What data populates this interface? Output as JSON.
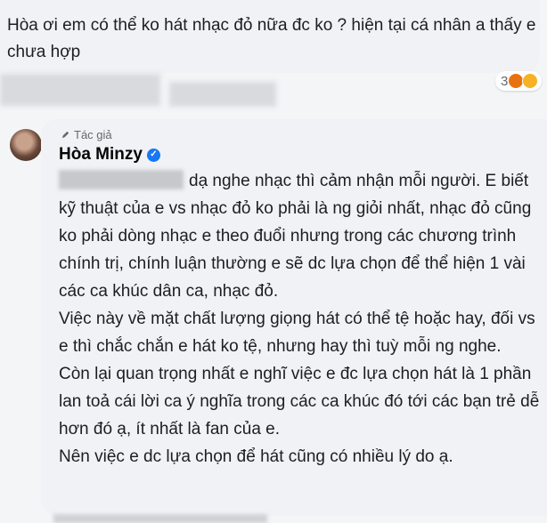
{
  "top_comment": {
    "text": "Hòa ơi em có thể ko hát nhạc đỏ nữa đc ko ? hiện tại cá nhân a thấy e chưa hợp",
    "reaction_count": "3",
    "reactions": [
      "angry-emoji",
      "haha-emoji"
    ]
  },
  "reply": {
    "author_tag": "Tác giả",
    "author_name": "Hòa Minzy",
    "paragraphs": [
      "dạ nghe nhạc thì cảm nhận mỗi người. E biết kỹ thuật của e vs nhạc đỏ ko phải là ng giỏi nhất, nhạc đỏ cũng ko phải dòng nhạc e theo đuổi nhưng trong các chương trình chính trị, chính luận thường e sẽ dc lựa chọn để thể hiện 1 vài các ca khúc dân ca, nhạc đỏ.",
      "Việc này về mặt chất lượng giọng hát có thể tệ hoặc hay, đối vs e thì chắc chắn e hát ko tệ, nhưng hay thì tuỳ mỗi ng nghe.",
      "Còn lại quan trọng nhất e nghĩ việc e đc lựa chọn hát là 1 phần lan toả cái lời ca ý nghĩa trong các ca khúc đó tới các bạn trẻ dễ hơn đó ạ, ít nhất là fan của e.",
      "Nên việc e dc lựa chọn để hát cũng có nhiều lý do ạ."
    ]
  },
  "colors": {
    "bubble": "#f0f2f5",
    "verified": "#1877f2",
    "text": "#1c1e21"
  }
}
